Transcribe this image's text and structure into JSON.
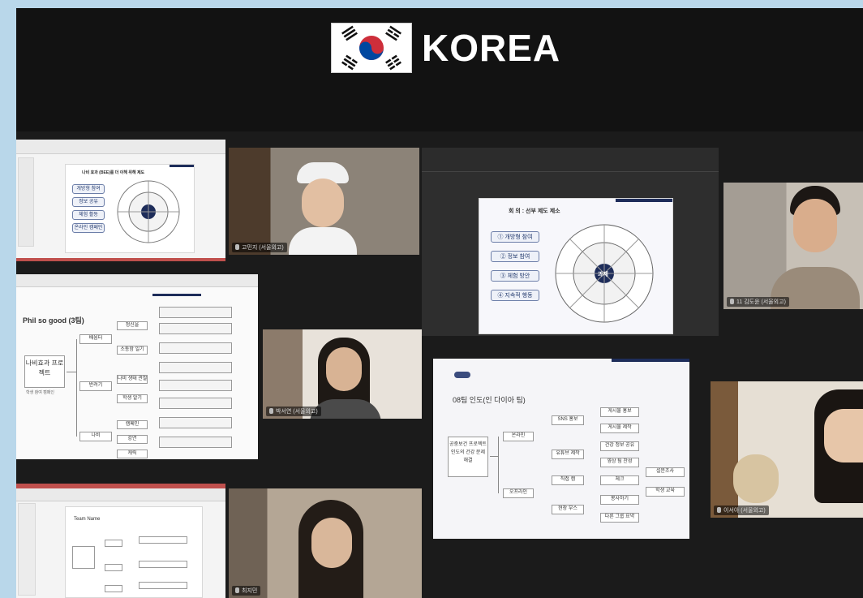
{
  "banner": {
    "title": "KOREA",
    "flag_icon": "south-korea-flag-icon"
  },
  "colors": {
    "background": "#b9d7ea",
    "stage": "#1b1b1b",
    "navy": "#1e2d5a",
    "flag_red": "#cd2e3a",
    "flag_blue": "#0047a0"
  },
  "shares": {
    "tl_ppt": {
      "slide_title": "나비 효과 (BEE)를 더 이해 위해 제도",
      "pills": [
        "개방형 참여",
        "정보 공유",
        "체험 활동",
        "온라인 캠페인"
      ]
    },
    "mid_ppt": {
      "slide_title": "회 의 : 선부 제도 제소",
      "pills": [
        "① 개방형 참여",
        "② 정보 참여",
        "③ 체험 방안",
        "④ 지속적 행동"
      ],
      "center_label": "과제"
    },
    "ml_mindmap": {
      "heading": "Phil so good (3팀)",
      "root": "나비효과 프로젝트",
      "root_sub": "학생 참여 캠페인",
      "branches": [
        "배움터",
        "반려기",
        "나비"
      ],
      "nodes": [
        "정신을",
        "소통함 일기",
        "나비 생태 관찰",
        "학생 알기",
        "캠페인",
        "강연",
        "캐릭"
      ]
    },
    "mr_mindmap": {
      "heading": "08팀 인도(인 다이아 팀)",
      "root": "공중보건 프로젝트",
      "root_sub": "인도의 건강 문제 해결",
      "branches": [
        "온라인",
        "오프라인"
      ],
      "nodes": [
        "SNS 홍보",
        "유튜브 제작",
        "직접 캠",
        "현장 부스",
        "게시물 홍보",
        "게시물 제작",
        "건강 정보 공유",
        "영상 팀 찬성",
        "체크",
        "봉사하기",
        "다른 그룹 요약",
        "설문조사",
        "학생 교육"
      ]
    },
    "bl_ppt": {
      "slide_title": "Team Name"
    }
  },
  "participants": [
    {
      "id": "p1",
      "name": "고민지 (서울외고)"
    },
    {
      "id": "p2",
      "name": "11 김도윤 (서울외고)"
    },
    {
      "id": "p3",
      "name": "박서연 (서울외고)"
    },
    {
      "id": "p4",
      "name": "이서아 (서울외고)"
    },
    {
      "id": "p5",
      "name": "최지민"
    }
  ]
}
